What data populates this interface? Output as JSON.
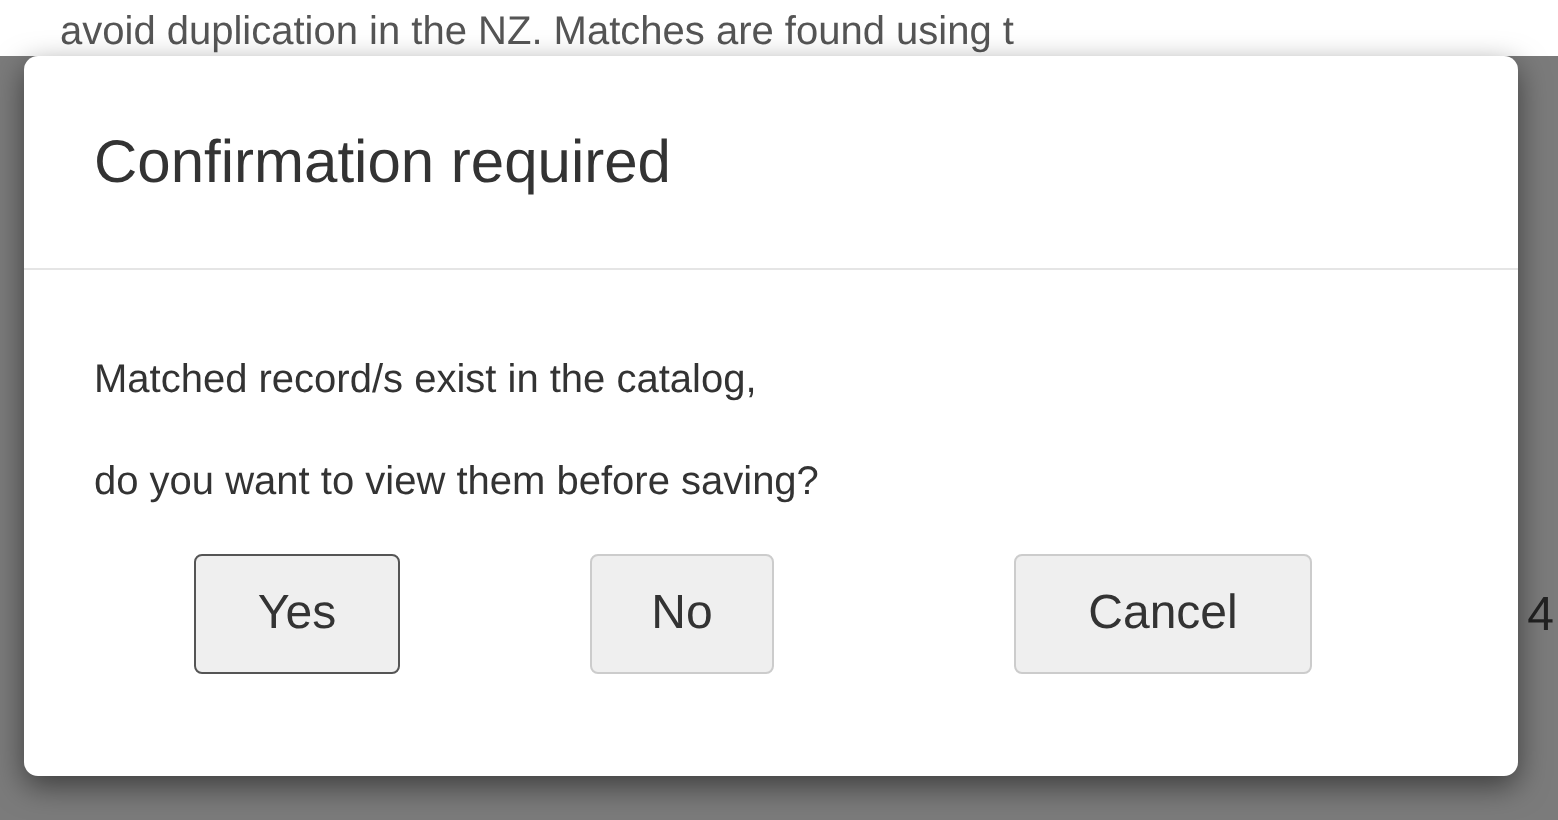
{
  "background": {
    "text": "avoid duplication in the NZ. Matches are found using t",
    "fragment": "4"
  },
  "dialog": {
    "title": "Confirmation required",
    "message": [
      "Matched record/s exist in the catalog,",
      "do you want to view them before saving?"
    ],
    "buttons": [
      {
        "label": "Yes",
        "focused": true
      },
      {
        "label": "No",
        "focused": false
      },
      {
        "label": "Cancel",
        "focused": false
      }
    ]
  }
}
